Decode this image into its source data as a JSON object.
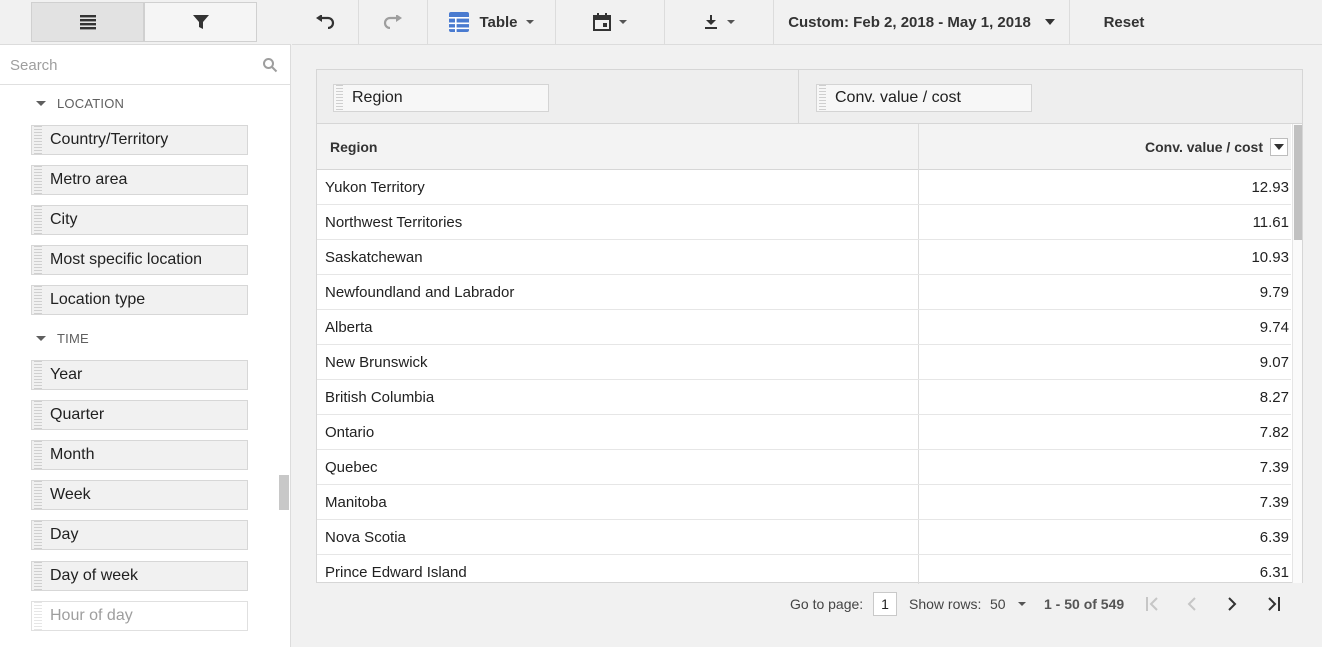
{
  "left_panel": {
    "search_placeholder": "Search",
    "groups": [
      {
        "label": "LOCATION",
        "items": [
          "Country/Territory",
          "Metro area",
          "City",
          "Most specific location",
          "Location type"
        ]
      },
      {
        "label": "TIME",
        "items": [
          "Year",
          "Quarter",
          "Month",
          "Week",
          "Day",
          "Day of week",
          "Hour of day"
        ]
      }
    ]
  },
  "toolbar": {
    "view_label": "Table",
    "date_range": "Custom: Feb 2, 2018 - May 1, 2018",
    "reset_label": "Reset"
  },
  "table": {
    "row_pill": "Region",
    "metric_pill": "Conv. value / cost",
    "headers": [
      "Region",
      "Conv. value / cost"
    ],
    "rows": [
      [
        "Yukon Territory",
        "12.93"
      ],
      [
        "Northwest Territories",
        "11.61"
      ],
      [
        "Saskatchewan",
        "10.93"
      ],
      [
        "Newfoundland and Labrador",
        "9.79"
      ],
      [
        "Alberta",
        "9.74"
      ],
      [
        "New Brunswick",
        "9.07"
      ],
      [
        "British Columbia",
        "8.27"
      ],
      [
        "Ontario",
        "7.82"
      ],
      [
        "Quebec",
        "7.39"
      ],
      [
        "Manitoba",
        "7.39"
      ],
      [
        "Nova Scotia",
        "6.39"
      ],
      [
        "Prince Edward Island",
        "6.31"
      ]
    ]
  },
  "pagination": {
    "go_to_label": "Go to page:",
    "page_value": "1",
    "show_rows_label": "Show rows:",
    "rows_value": "50",
    "range_text": "1 - 50 of 549"
  },
  "colors": {
    "accent_blue": "#4a7bd0"
  }
}
